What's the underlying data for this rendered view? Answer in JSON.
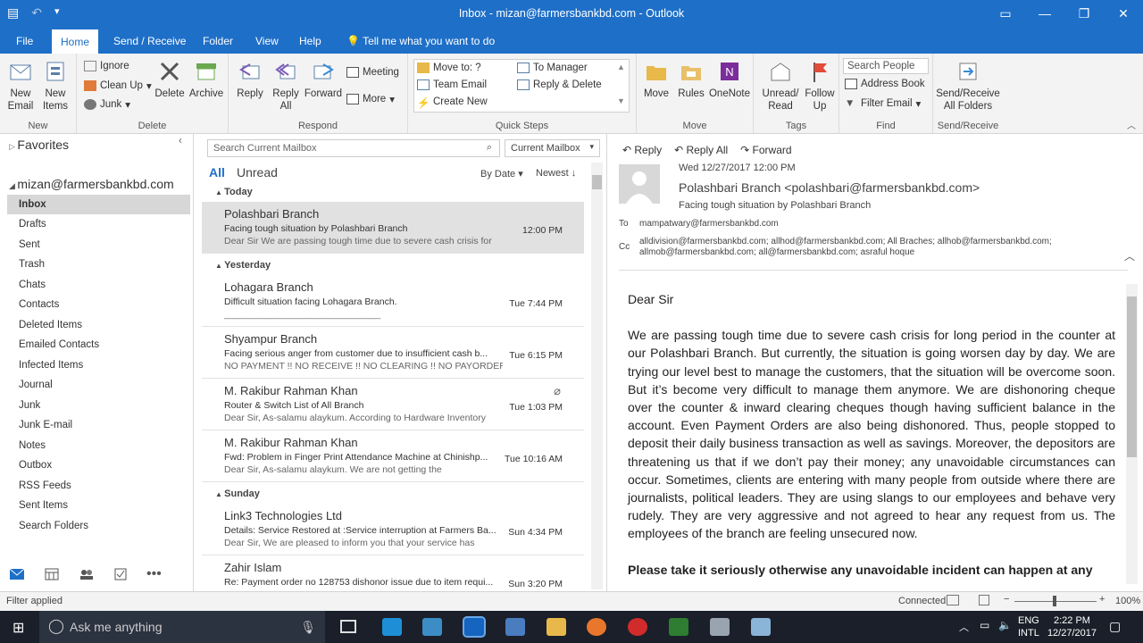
{
  "window": {
    "title": "Inbox - mizan@farmersbankbd.com  -  Outlook"
  },
  "tabs": [
    "File",
    "Home",
    "Send / Receive",
    "Folder",
    "View",
    "Help"
  ],
  "tell_me": "Tell me what you want to do",
  "ribbon": {
    "new_email": "New Email",
    "new_items": "New Items",
    "ignore": "Ignore",
    "clean_up": "Clean Up",
    "junk": "Junk",
    "delete": "Delete",
    "archive": "Archive",
    "reply": "Reply",
    "reply_all": "Reply All",
    "forward": "Forward",
    "meeting": "Meeting",
    "more": "More",
    "qs_move_to": "Move to: ?",
    "qs_team_email": "Team Email",
    "qs_create_new": "Create New",
    "qs_to_manager": "To Manager",
    "qs_reply_delete": "Reply & Delete",
    "move": "Move",
    "rules": "Rules",
    "onenote": "OneNote",
    "unread_read": "Unread/ Read",
    "follow_up": "Follow Up",
    "search_people": "Search People",
    "address_book": "Address Book",
    "filter_email": "Filter Email",
    "send_receive_all": "Send/Receive All Folders",
    "groups": [
      "New",
      "Delete",
      "Respond",
      "Quick Steps",
      "Move",
      "Tags",
      "Find",
      "Send/Receive"
    ]
  },
  "folders": {
    "favorites": "Favorites",
    "account": "mizan@farmersbankbd.com",
    "items": [
      "Inbox",
      "Drafts",
      "Sent",
      "Trash",
      "Chats",
      "Contacts",
      "Deleted Items",
      "Emailed Contacts",
      "Infected Items",
      "Journal",
      "Junk",
      "Junk E-mail",
      "Notes",
      "Outbox",
      "RSS Feeds",
      "Sent Items",
      "Search Folders"
    ]
  },
  "list": {
    "search_placeholder": "Search Current Mailbox",
    "scope": "Current Mailbox",
    "filter_all": "All",
    "filter_unread": "Unread",
    "sort_by": "By Date",
    "sort_order": "Newest",
    "groups": {
      "today": "Today",
      "yesterday": "Yesterday",
      "sunday": "Sunday"
    },
    "mails": [
      {
        "from": "Polashbari Branch",
        "subject": "Facing tough situation by Polashbari Branch",
        "preview": "Dear Sir  We are passing tough time due to severe cash crisis for",
        "time": "12:00 PM"
      },
      {
        "from": "Lohagara Branch",
        "subject": "Difficult situation facing Lohagara Branch.",
        "preview": "______________________________",
        "time": "Tue 7:44 PM"
      },
      {
        "from": "Shyampur Branch",
        "subject": "Facing serious anger from customer due to insufficient cash b...",
        "preview": "NO PAYMENT !! NO RECEIVE !! NO CLEARING !! NO PAYORDER !!",
        "time": "Tue 6:15 PM"
      },
      {
        "from": "M. Rakibur Rahman Khan",
        "subject": "Router & Switch List of All Branch",
        "preview": "Dear Sir,  As-salamu alaykum.  According to Hardware Inventory",
        "time": "Tue 1:03 PM"
      },
      {
        "from": "M. Rakibur Rahman Khan",
        "subject": "Fwd: Problem in Finger Print Attendance Machine at Chinishp...",
        "preview": "Dear Sir,  As-salamu alaykum.  We are not getting the",
        "time": "Tue 10:16 AM"
      },
      {
        "from": "Link3 Technologies Ltd",
        "subject": "Details: Service Restored at :Service interruption at Farmers Ba...",
        "preview": "Dear Sir,   We are pleased to inform you that your service has",
        "time": "Sun 4:34 PM"
      },
      {
        "from": "Zahir Islam",
        "subject": "Re: Payment order no 128753 dishonor issue due to item requi...",
        "preview": "",
        "time": "Sun 3:20 PM"
      }
    ]
  },
  "reading": {
    "reply": "Reply",
    "reply_all": "Reply All",
    "forward": "Forward",
    "date": "Wed 12/27/2017 12:00 PM",
    "sender": "Polashbari Branch <polashbari@farmersbankbd.com>",
    "subject": "Facing tough situation by Polashbari Branch",
    "to_label": "To",
    "to": "mampatwary@farmersbankbd.com",
    "cc_label": "Cc",
    "cc_line1": "alldivision@farmersbankbd.com; allhod@farmersbankbd.com; All Braches; allhob@farmersbankbd.com;",
    "cc_line2": "allmob@farmersbankbd.com; all@farmersbankbd.com; asraful hoque",
    "greeting": "Dear Sir",
    "paragraph": "We are passing tough time due to severe cash crisis for long period in the counter at our Polashbari Branch. But currently, the situation is going worsen day by day. We are trying our level best to manage the customers, that the situation will be overcome soon. But it’s become very difficult to manage them anymore. We are dishonoring cheque over the counter & inward clearing cheques though having sufficient balance in the account. Even Payment Orders are also being dishonored. Thus, people stopped to deposit their daily business transaction as well as savings. Moreover, the depositors are threatening us that if we don’t pay their money; any unavoidable circumstances can occur. Sometimes, clients are entering with many people from outside where there are journalists, political leaders. They are using slangs to our employees and behave very rudely. They are very aggressive and not agreed to hear any request from us. The employees of the branch are feeling unsecured now.",
    "bold_line": "Please take it seriously otherwise any unavoidable incident can happen at any"
  },
  "status": {
    "left": "Filter applied",
    "connected": "Connected",
    "zoom": "100%"
  },
  "taskbar": {
    "search": "Ask me anything",
    "lang1": "ENG",
    "lang2": "INTL",
    "time": "2:22 PM",
    "date": "12/27/2017"
  }
}
